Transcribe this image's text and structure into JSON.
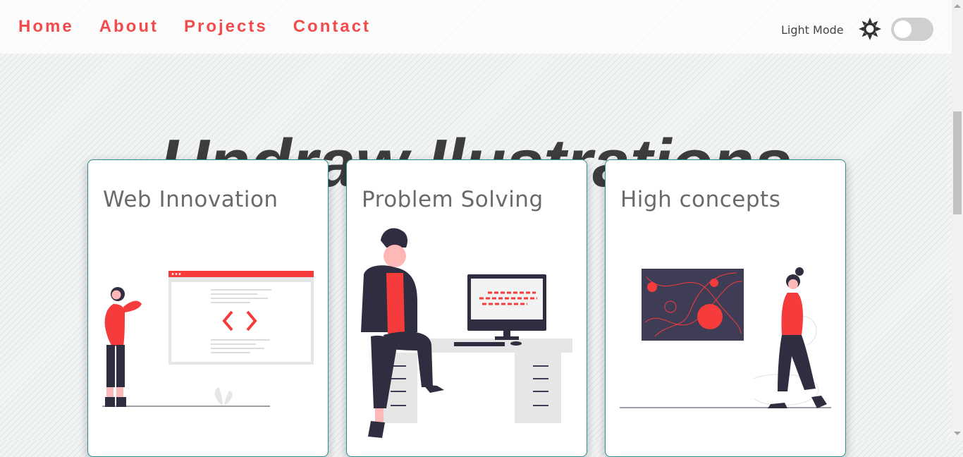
{
  "nav": {
    "items": [
      {
        "label": "Home"
      },
      {
        "label": "About"
      },
      {
        "label": "Projects"
      },
      {
        "label": "Contact"
      }
    ]
  },
  "theme": {
    "mode_label": "Light Mode",
    "icon": "sun-icon",
    "toggle_on": false
  },
  "hero": {
    "title": "Undraw Ilustrations"
  },
  "cards": [
    {
      "title": "Web Innovation"
    },
    {
      "title": "Problem Solving"
    },
    {
      "title": "High concepts"
    }
  ],
  "colors": {
    "accent": "#f24b4b",
    "red": "#f53b3b",
    "dark": "#2f2e41",
    "border": "#2a9090",
    "heading": "#3d3d3d"
  }
}
